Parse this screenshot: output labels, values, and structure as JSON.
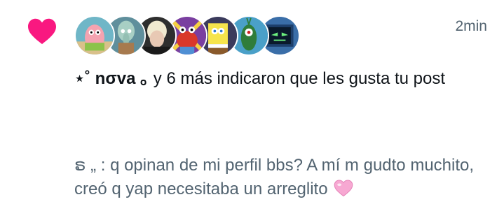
{
  "notification": {
    "timestamp": "2min",
    "liker_name": "⋆˚ nσva ｡",
    "like_message": " y 6 más indicaron que les gusta tu post",
    "post_text": "ຣ „ : q opinan de mi perfil bbs? A mí m gudto muchito, creó q yap necesitaba un arreglito",
    "icons": {
      "like": "heart-icon",
      "post_emoji": "pink-heart-emoji"
    },
    "colors": {
      "like_heart": "#f91880",
      "secondary_text": "#536471",
      "primary_text": "#0f1419",
      "pink_emoji": "#f7a8d2"
    },
    "avatars": [
      {
        "name": "avatar-patrick"
      },
      {
        "name": "avatar-squidward"
      },
      {
        "name": "avatar-person"
      },
      {
        "name": "avatar-mr-krabs"
      },
      {
        "name": "avatar-spongebob"
      },
      {
        "name": "avatar-plankton"
      },
      {
        "name": "avatar-karen"
      }
    ]
  }
}
